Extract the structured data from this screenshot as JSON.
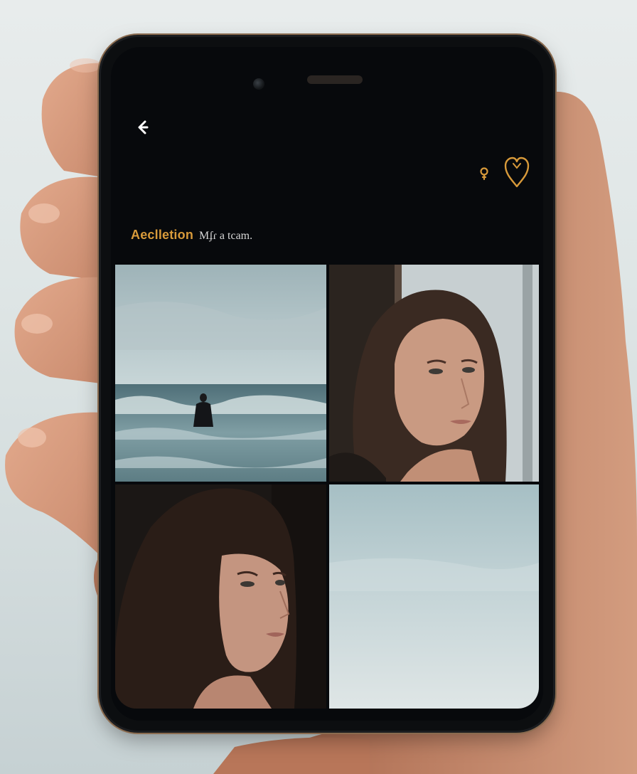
{
  "header": {
    "title_accent": "Aeclletion",
    "title_rest": "Mʄɾ a tcam."
  },
  "icons": {
    "back": "back-arrow-icon",
    "pin": "location-pin-icon",
    "heart": "heart-icon"
  },
  "colors": {
    "accent": "#d89a3a",
    "screen_bg": "#07090c"
  },
  "gallery": {
    "items": [
      {
        "subject": "ocean-scene"
      },
      {
        "subject": "woman-portrait-window"
      },
      {
        "subject": "woman-portrait-dark"
      },
      {
        "subject": "sky"
      }
    ]
  }
}
